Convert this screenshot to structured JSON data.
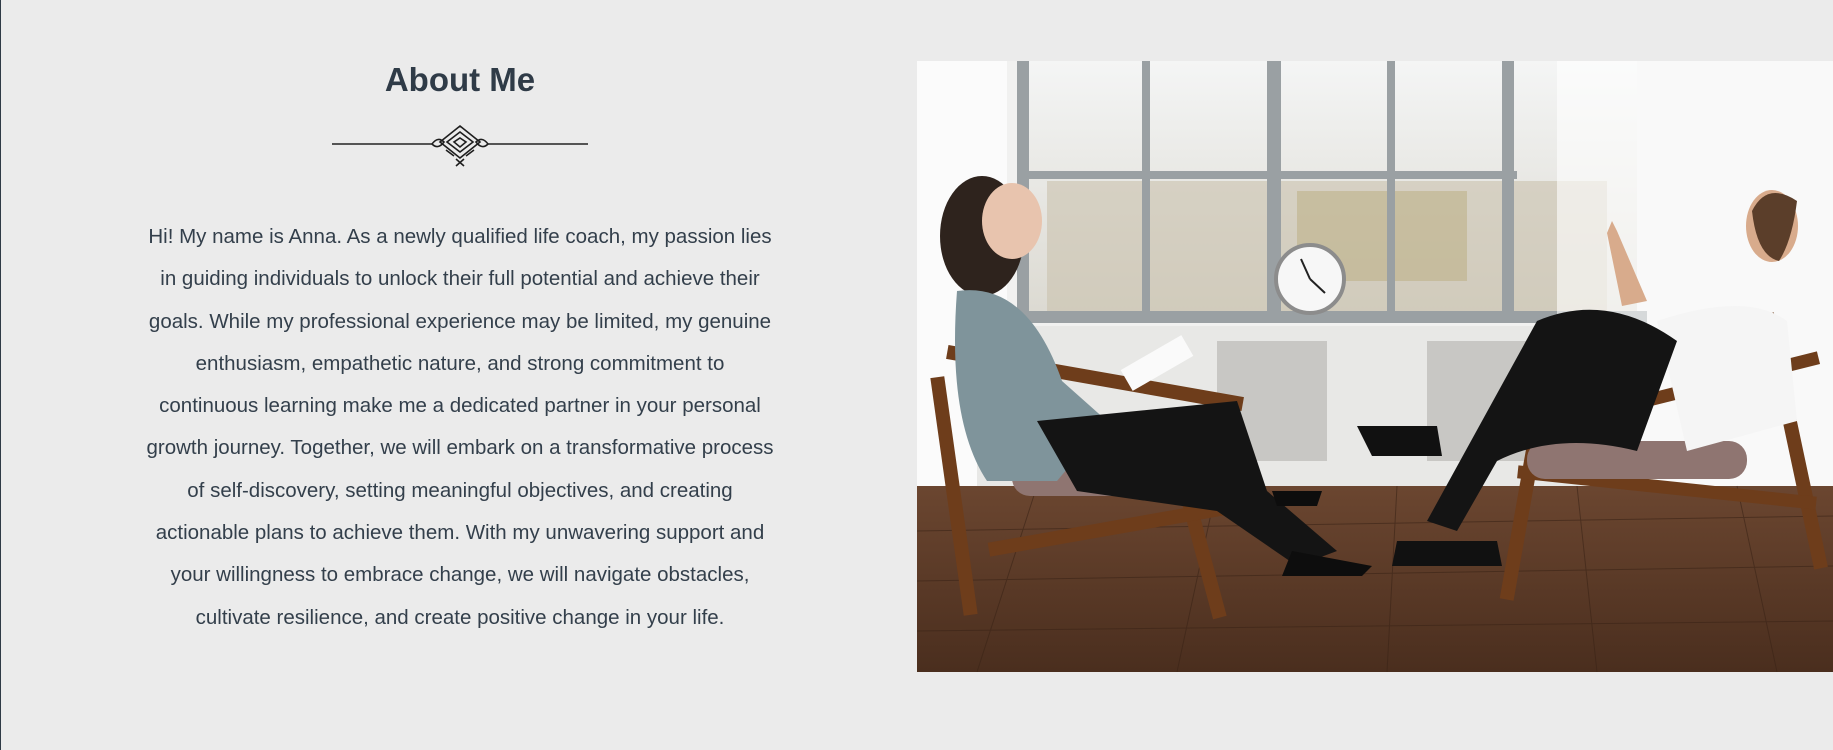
{
  "about": {
    "title": "About Me",
    "divider_icon": "ornamental-flourish-icon",
    "bio": "Hi! My name is Anna. As a newly qualified life coach, my passion lies in guiding individuals to unlock their full potential and achieve their goals. While my professional experience may be limited, my genuine enthusiasm, empathetic nature, and strong commitment to continuous learning make me a dedicated partner in your personal growth journey. Together, we will embark on a transformative process of self-discovery, setting meaningful objectives, and creating actionable plans to achieve them. With my unwavering support and your willingness to embrace change, we will navigate obstacles, cultivate resilience, and create positive change in your life."
  },
  "photo": {
    "subject": "coaching-session-photo"
  },
  "colors": {
    "background": "#ebebeb",
    "text": "#2f3b47"
  }
}
